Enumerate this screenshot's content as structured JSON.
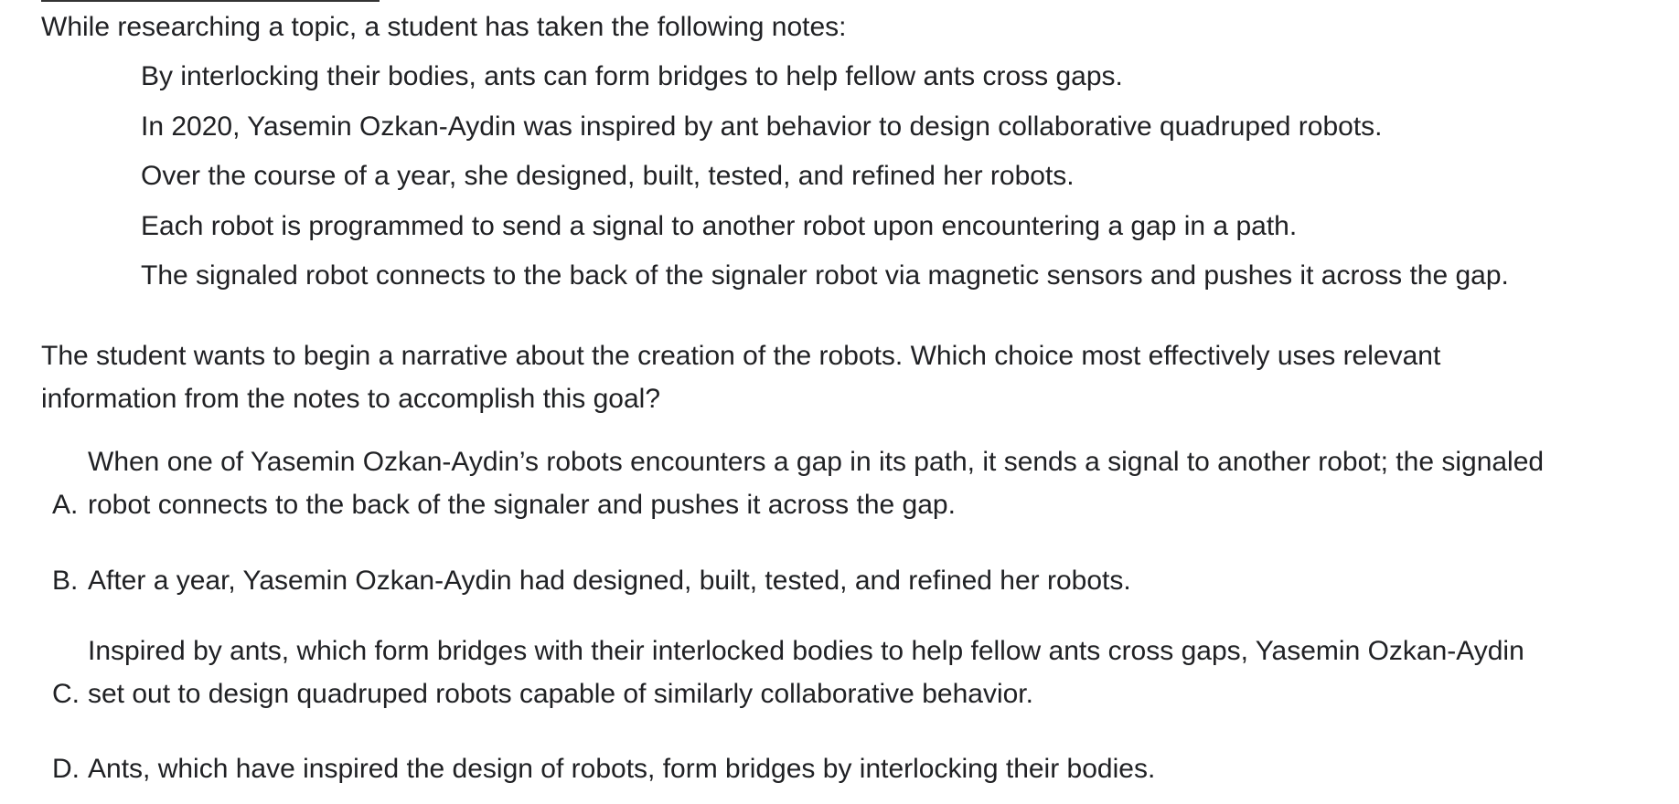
{
  "intro": "While researching a topic, a student has taken the following notes:",
  "notes": [
    "By interlocking their bodies, ants can form bridges to help fellow ants cross gaps.",
    "In 2020, Yasemin Ozkan-Aydin was inspired by ant behavior to design collaborative quadruped robots.",
    "Over the course of a year, she designed, built, tested, and refined her robots.",
    "Each robot is programmed to send a signal to another robot upon encountering a gap in a path.",
    "The signaled robot connects to the back of the signaler robot via magnetic sensors and pushes it across the gap."
  ],
  "question": [
    "The student wants to begin a narrative about the creation of the robots. Which choice most effectively uses relevant",
    "information from the notes to accomplish this goal?"
  ],
  "options": [
    {
      "label": "A.",
      "lines": [
        "When one of Yasemin Ozkan-Aydin’s robots encounters a gap in its path, it sends a signal to another robot; the signaled",
        "robot connects to the back of the signaler and pushes it across the gap."
      ]
    },
    {
      "label": "B.",
      "lines": [
        "After a year, Yasemin Ozkan-Aydin had designed, built, tested, and refined her robots."
      ]
    },
    {
      "label": "C.",
      "lines": [
        "Inspired by ants, which form bridges with their interlocked bodies to help fellow ants cross gaps, Yasemin Ozkan-Aydin",
        "set out to design quadruped robots capable of similarly collaborative behavior."
      ]
    },
    {
      "label": "D.",
      "lines": [
        "Ants, which have inspired the design of robots, form bridges by interlocking their bodies."
      ]
    }
  ]
}
